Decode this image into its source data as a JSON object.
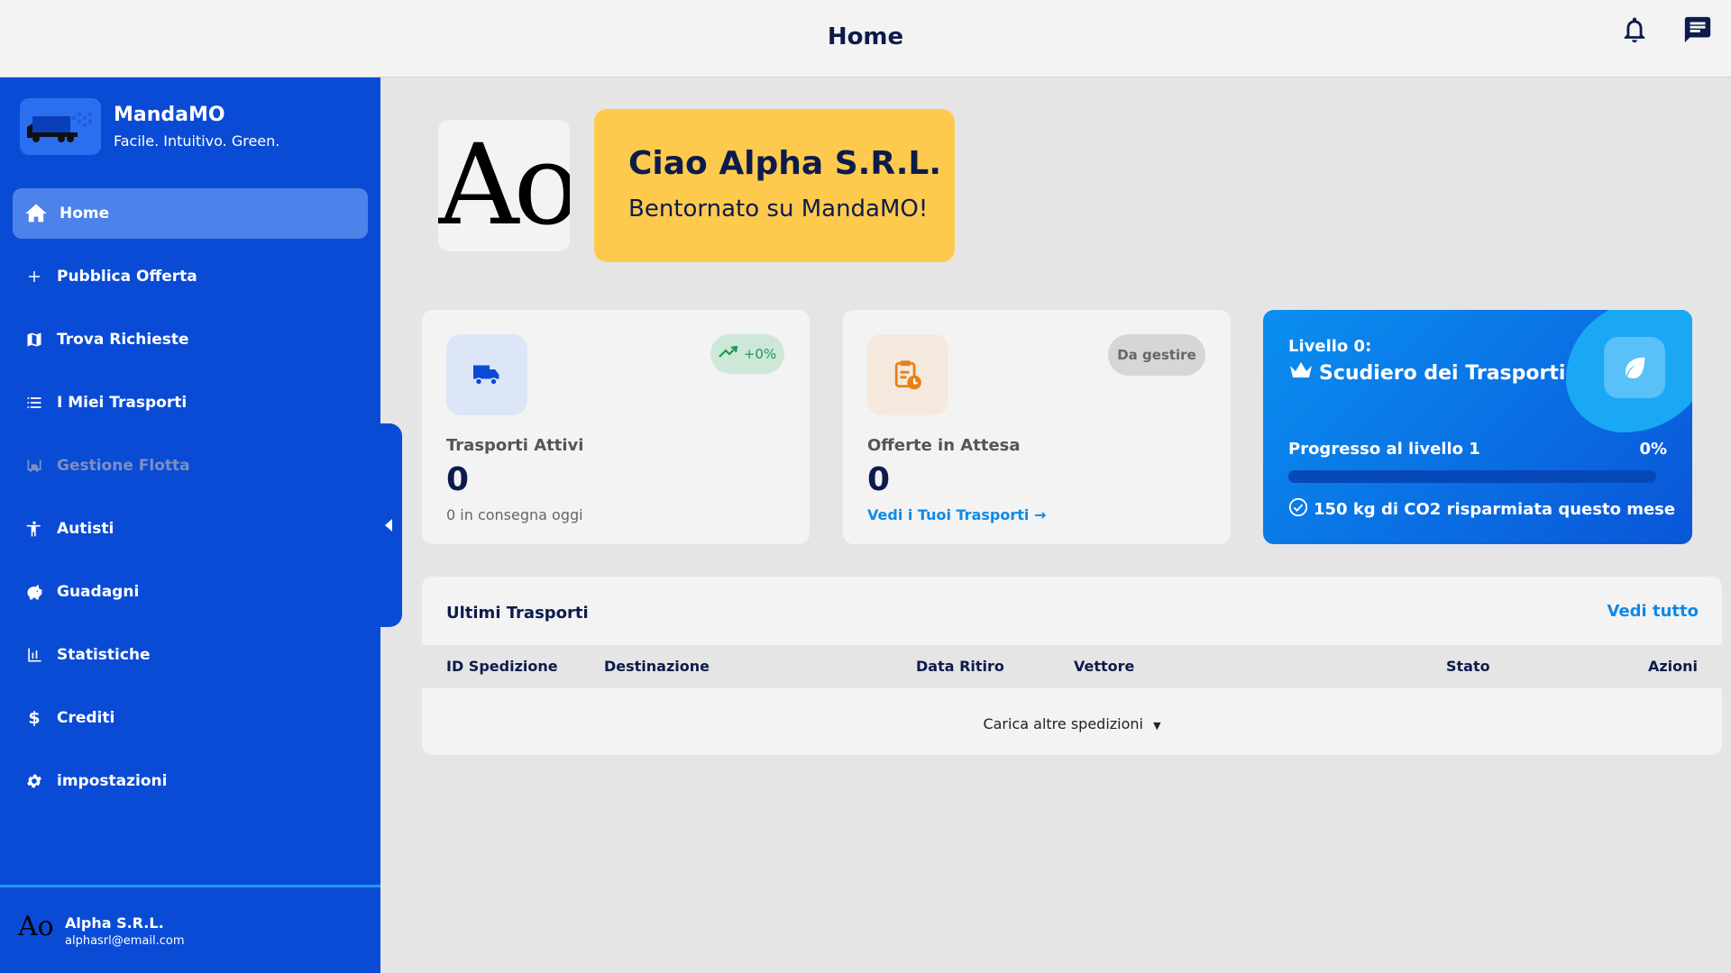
{
  "header": {
    "title": "Home",
    "notifications_icon": "bell-icon",
    "messages_icon": "chat-icon"
  },
  "brand": {
    "name": "MandaMO",
    "tagline": "Facile. Intuitivo. Green."
  },
  "sidebar": {
    "items": [
      {
        "label": "Home",
        "icon": "home-icon",
        "state": "active"
      },
      {
        "label": "Pubblica Offerta",
        "icon": "plus-icon",
        "state": "normal"
      },
      {
        "label": "Trova Richieste",
        "icon": "map-icon",
        "state": "normal"
      },
      {
        "label": "I Miei Trasporti",
        "icon": "list-icon",
        "state": "normal"
      },
      {
        "label": "Gestione Flotta",
        "icon": "forklift-icon",
        "state": "disabled"
      },
      {
        "label": "Autisti",
        "icon": "person-icon",
        "state": "normal"
      },
      {
        "label": "Guadagni",
        "icon": "piggy-bank-icon",
        "state": "normal"
      },
      {
        "label": "Statistiche",
        "icon": "bar-chart-icon",
        "state": "normal"
      },
      {
        "label": "Crediti",
        "icon": "dollar-icon",
        "state": "normal"
      },
      {
        "label": "impostazioni",
        "icon": "gear-icon",
        "state": "normal"
      }
    ]
  },
  "user": {
    "avatar_text": "Ao",
    "name": "Alpha S.R.L.",
    "email": "alphasrl@email.com"
  },
  "greeting": {
    "avatar_text": "Ao",
    "hello": "Ciao Alpha S.R.L.",
    "welcome": "Bentornato su MandaMO!"
  },
  "stats": {
    "active": {
      "label": "Trasporti Attivi",
      "value": "0",
      "sub": "0 in consegna oggi",
      "trend": "+0%",
      "icon": "truck-icon"
    },
    "pending": {
      "label": "Offerte in Attesa",
      "value": "0",
      "badge": "Da gestire",
      "link": "Vedi i Tuoi Trasporti",
      "icon": "clipboard-clock-icon"
    }
  },
  "level": {
    "level_label": "Livello 0:",
    "title": "Scudiero dei Trasporti",
    "progress_label": "Progresso al livello 1",
    "progress_percent": "0%",
    "progress_value": 0,
    "co2": "150 kg di CO2 risparmiata questo mese"
  },
  "transports": {
    "title": "Ultimi Trasporti",
    "see_all": "Vedi tutto",
    "columns": [
      "ID Spedizione",
      "Destinazione",
      "Data Ritiro",
      "Vettore",
      "Stato",
      "Azioni"
    ],
    "load_more": "Carica altre spedizioni"
  },
  "colors": {
    "sidebar": "#0a4bd6",
    "accent": "#0d8ae8",
    "greeting_bg": "#fdca4e",
    "text_dark": "#0d1b4c"
  }
}
